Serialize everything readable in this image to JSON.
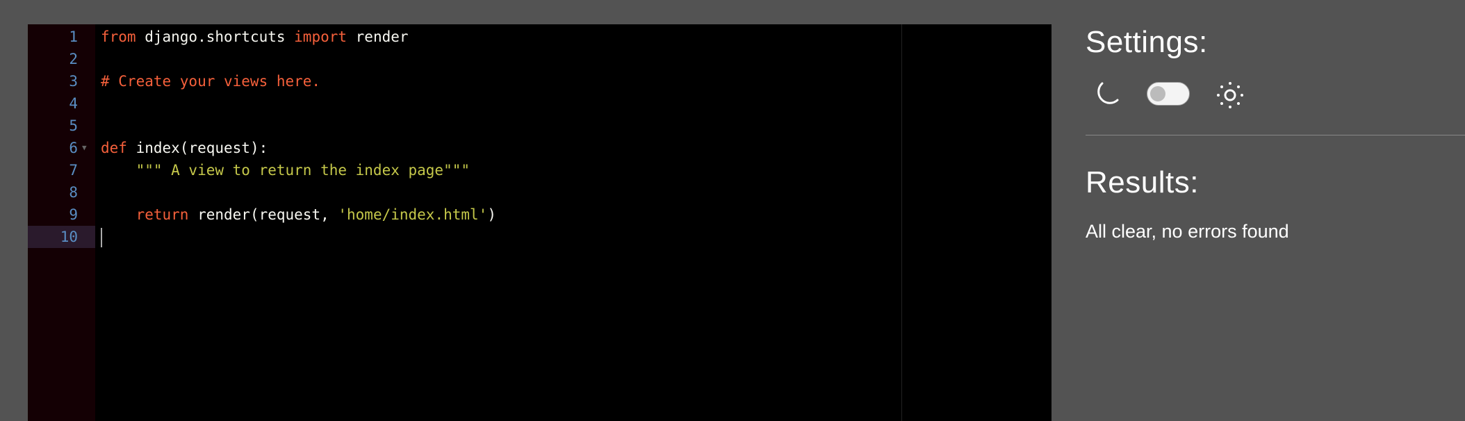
{
  "editor": {
    "active_line": 10,
    "lines": [
      {
        "n": "1",
        "tokens": [
          [
            "kw",
            "from"
          ],
          [
            "",
            ""
          ],
          [
            "",
            " django.shortcuts "
          ],
          [
            "kw",
            "import"
          ],
          [
            "",
            " render"
          ]
        ]
      },
      {
        "n": "2",
        "tokens": []
      },
      {
        "n": "3",
        "tokens": [
          [
            "cm",
            "# Create your views here."
          ]
        ]
      },
      {
        "n": "4",
        "tokens": []
      },
      {
        "n": "5",
        "tokens": []
      },
      {
        "n": "6",
        "fold": true,
        "tokens": [
          [
            "kw",
            "def"
          ],
          [
            "",
            " index(request):"
          ]
        ]
      },
      {
        "n": "7",
        "tokens": [
          [
            "st",
            "    \"\"\" A view to return the index page\"\"\""
          ]
        ]
      },
      {
        "n": "8",
        "tokens": []
      },
      {
        "n": "9",
        "tokens": [
          [
            "",
            "    "
          ],
          [
            "kw",
            "return"
          ],
          [
            "",
            " render(request, "
          ],
          [
            "st",
            "'home/index.html'"
          ],
          [
            "",
            ")"
          ]
        ]
      },
      {
        "n": "10",
        "tokens": []
      }
    ]
  },
  "settings": {
    "title": "Settings:",
    "theme_toggle_on": false,
    "dark_icon": "moon-icon",
    "light_icon": "sun-icon"
  },
  "results": {
    "title": "Results:",
    "message": "All clear, no errors found"
  },
  "colors": {
    "keyword": "#f5603b",
    "string": "#c5c84a",
    "line_number": "#5a8ec4",
    "background": "#535353"
  }
}
